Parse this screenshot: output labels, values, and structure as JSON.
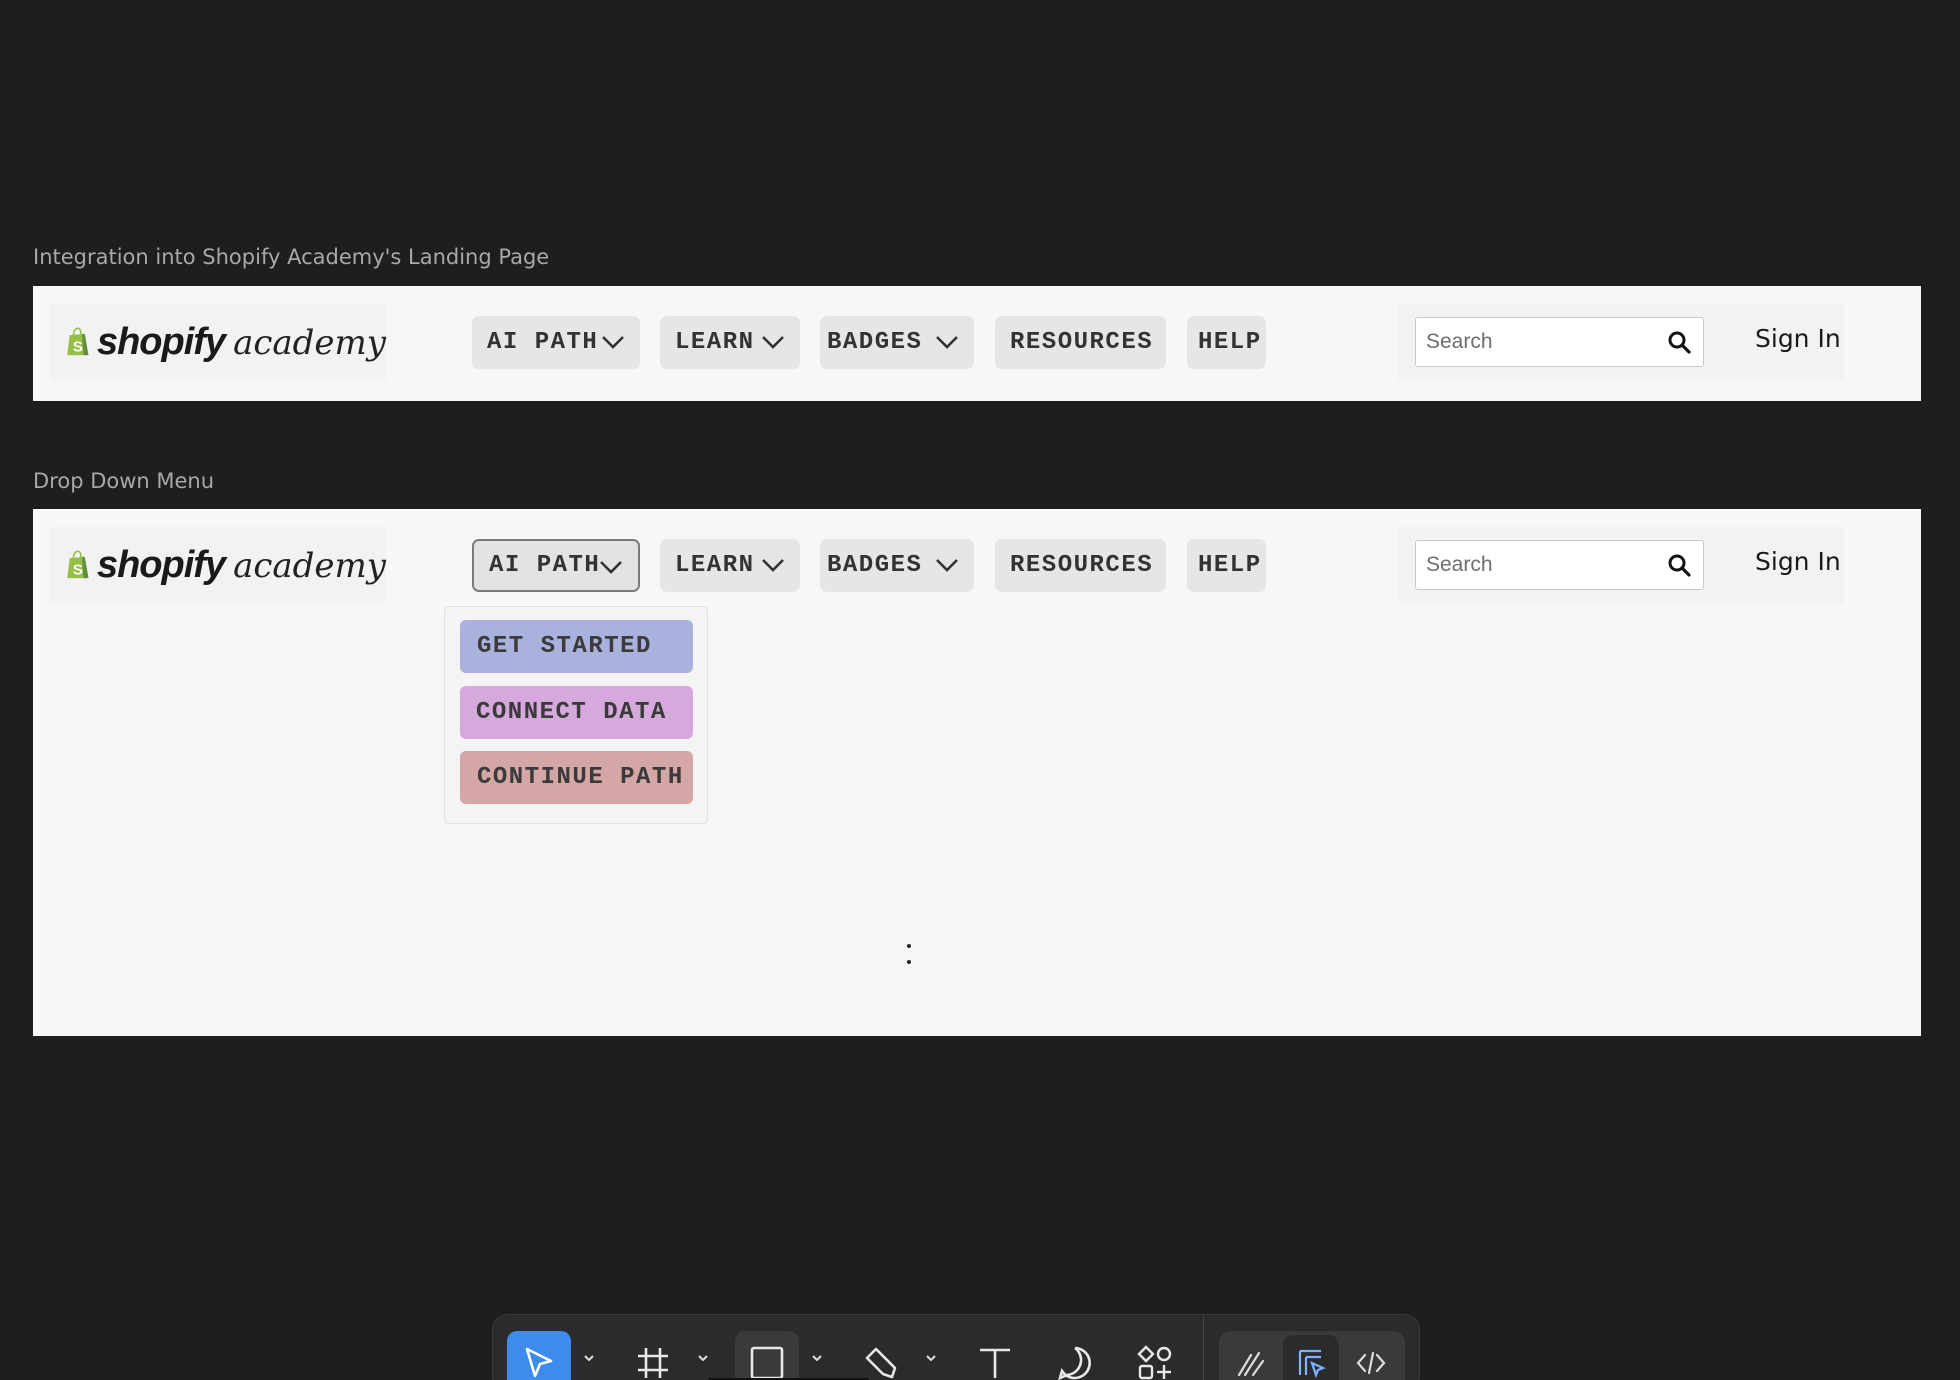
{
  "sections": [
    {
      "label": "Integration into Shopify Academy's Landing Page",
      "header": {
        "logo_word1": "shopify",
        "logo_word2": "academy",
        "nav": [
          "AI PATH",
          "LEARN",
          "BADGES",
          "RESOURCES",
          "HELP"
        ],
        "search_placeholder": "Search",
        "signin": "Sign In"
      }
    },
    {
      "label": "Drop Down Menu",
      "header": {
        "logo_word1": "shopify",
        "logo_word2": "academy",
        "nav": [
          "AI PATH",
          "LEARN",
          "BADGES",
          "RESOURCES",
          "HELP"
        ],
        "search_placeholder": "Search",
        "signin": "Sign In"
      },
      "dropdown": {
        "items": [
          {
            "label": "GET STARTED",
            "color": "#a9b1dc"
          },
          {
            "label": "CONNECT DATA",
            "color": "#d6a9dc"
          },
          {
            "label": "CONTINUE PATH",
            "color": "#d4a6a6"
          }
        ]
      }
    }
  ],
  "colors": {
    "canvas": "#1e1e1e",
    "frame": "#f7f7f7",
    "nav_button": "#e6e6e6",
    "logo_green": "#95bf47",
    "tool_selected": "#3d8bea"
  },
  "toolbar": {
    "tools": [
      "move-icon",
      "frame-icon",
      "rectangle-icon",
      "pen-icon",
      "text-icon",
      "comment-icon",
      "assets-icon"
    ],
    "modes": [
      "draw-mode-icon",
      "design-mode-icon",
      "dev-mode-icon"
    ]
  }
}
